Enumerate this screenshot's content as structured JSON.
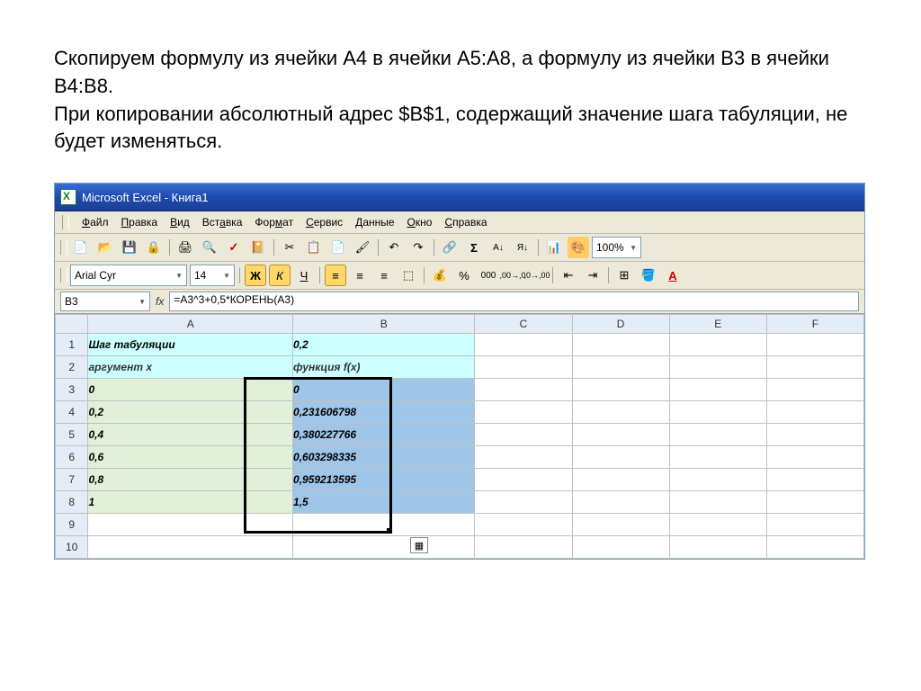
{
  "description": {
    "line1": "Скопируем формулу из ячейки A4 в ячейки A5:A8, а формулу из ячейки B3 в ячейки B4:B8.",
    "line2": "При копировании абсолютный адрес $B$1, содержащий значение шага табуляции, не будет изменяться."
  },
  "title": "Microsoft Excel - Книга1",
  "menu": {
    "file": "Файл",
    "edit": "Правка",
    "view": "Вид",
    "insert": "Вставка",
    "format": "Формат",
    "tools": "Сервис",
    "data": "Данные",
    "window": "Окно",
    "help": "Справка"
  },
  "font": {
    "name": "Arial Cyr",
    "size": "14"
  },
  "zoom": "100%",
  "namebox": "B3",
  "formula": "=A3^3+0,5*КОРЕНЬ(A3)",
  "cols": [
    "A",
    "B",
    "C",
    "D",
    "E",
    "F"
  ],
  "rows": {
    "r1": {
      "a": "Шаг табуляции",
      "b": "0,2"
    },
    "r2": {
      "a": "аргумент x",
      "b": "функция f(x)"
    },
    "r3": {
      "a": "0",
      "b": "0"
    },
    "r4": {
      "a": "0,2",
      "b": "0,231606798"
    },
    "r5": {
      "a": "0,4",
      "b": "0,380227766"
    },
    "r6": {
      "a": "0,6",
      "b": "0,603298335"
    },
    "r7": {
      "a": "0,8",
      "b": "0,959213595"
    },
    "r8": {
      "a": "1",
      "b": "1,5"
    }
  },
  "fmt": {
    "bold": "Ж",
    "italic": "К",
    "underline": "Ч"
  },
  "sym": {
    "currency": "₽",
    "percent": "%",
    "sum": "Σ"
  }
}
